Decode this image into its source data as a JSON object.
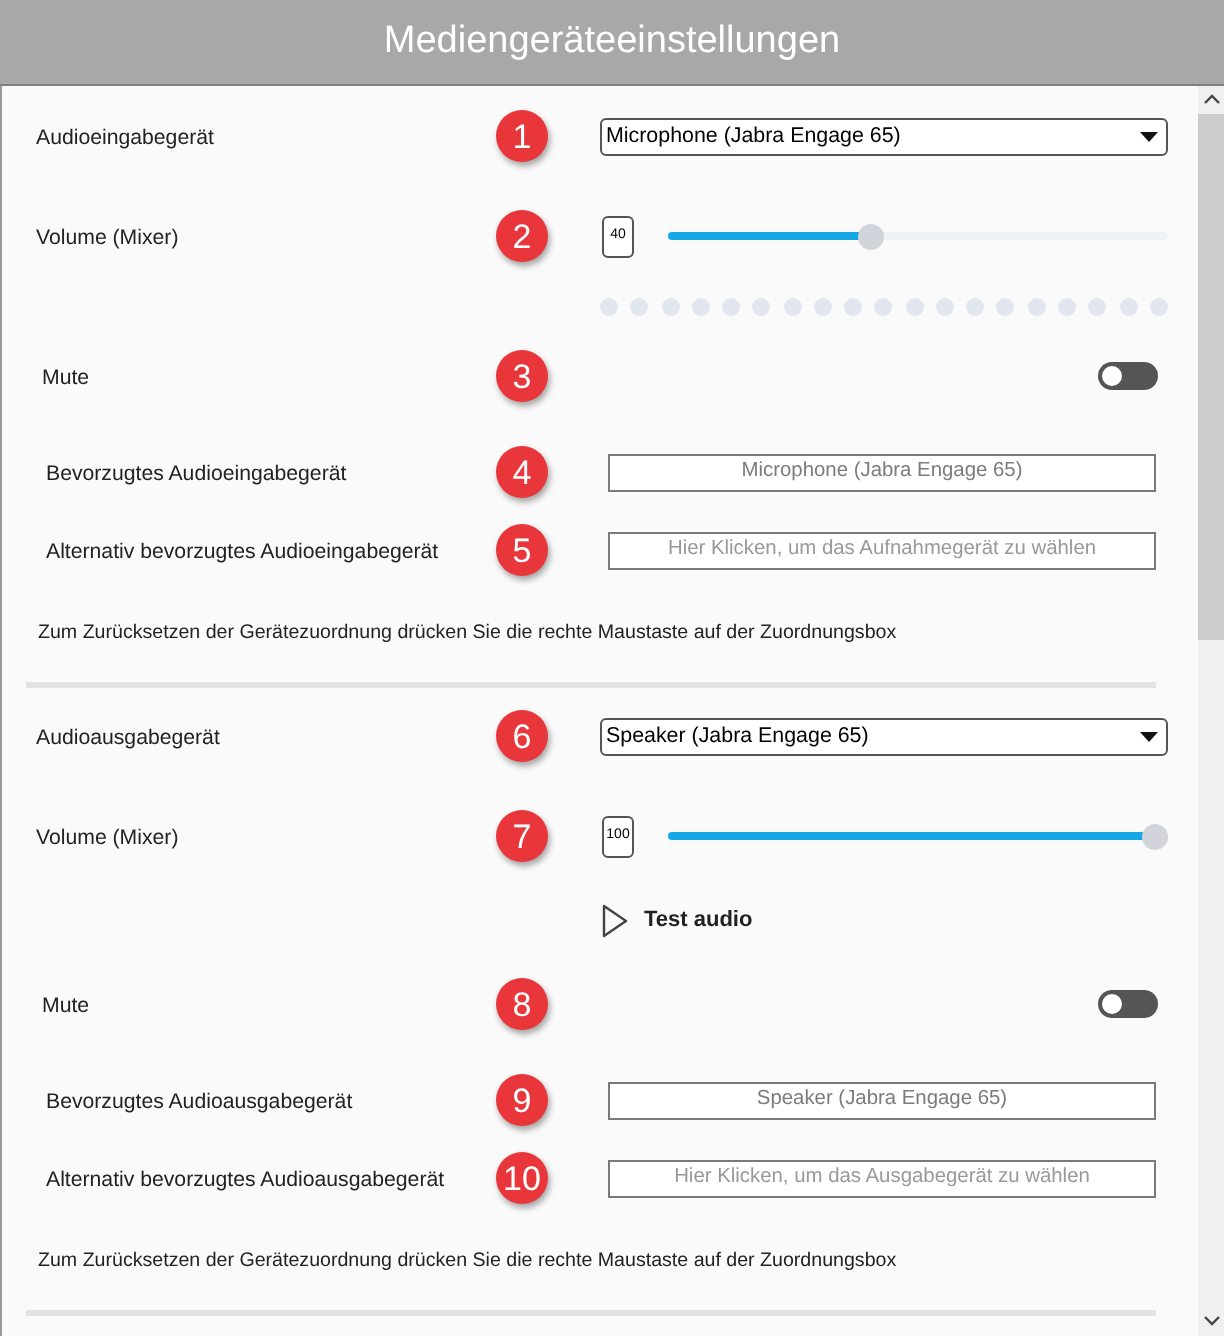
{
  "title": "Mediengeräteeinstellungen",
  "sections": [
    {
      "rows": [
        {
          "kind": "select",
          "label": "Audioeingabegerät",
          "marker": "1",
          "value": "Microphone (Jabra Engage 65)"
        },
        {
          "kind": "volume",
          "label": "Volume (Mixer)",
          "marker": "2",
          "reading": "40",
          "level": 0.4
        },
        {
          "kind": "meter"
        },
        {
          "kind": "toggle",
          "label": "Mute",
          "marker": "3",
          "on": false
        },
        {
          "kind": "field",
          "label": "Bevorzugtes Audioeingabegerät",
          "marker": "4",
          "value": "Microphone (Jabra Engage 65)"
        },
        {
          "kind": "field",
          "label": "Alternativ bevorzugtes Audioeingabegerät",
          "marker": "5",
          "placeholder": "Hier Klicken, um das Aufnahmegerät zu wählen"
        },
        {
          "kind": "note",
          "text": "Zum Zurücksetzen der Gerätezuordnung drücken Sie die rechte Maustaste auf der Zuordnungsbox"
        }
      ]
    },
    {
      "rows": [
        {
          "kind": "select",
          "label": "Audioausgabegerät",
          "marker": "6",
          "value": "Speaker (Jabra Engage 65)"
        },
        {
          "kind": "volume",
          "label": "Volume (Mixer)",
          "marker": "7",
          "reading": "100",
          "level": 1
        },
        {
          "kind": "test",
          "label": "Test audio"
        },
        {
          "kind": "toggle",
          "label": "Mute",
          "marker": "8",
          "on": false
        },
        {
          "kind": "field",
          "label": "Bevorzugtes Audioausgabegerät",
          "marker": "9",
          "value": "Speaker (Jabra Engage 65)"
        },
        {
          "kind": "field",
          "label": "Alternativ bevorzugtes Audioausgabegerät",
          "marker": "10",
          "placeholder": "Hier Klicken, um das Ausgabegerät zu wählen"
        },
        {
          "kind": "note",
          "text": "Zum Zurücksetzen der Gerätezuordnung drücken Sie die rechte Maustaste auf der Zuordnungsbox"
        }
      ]
    }
  ]
}
